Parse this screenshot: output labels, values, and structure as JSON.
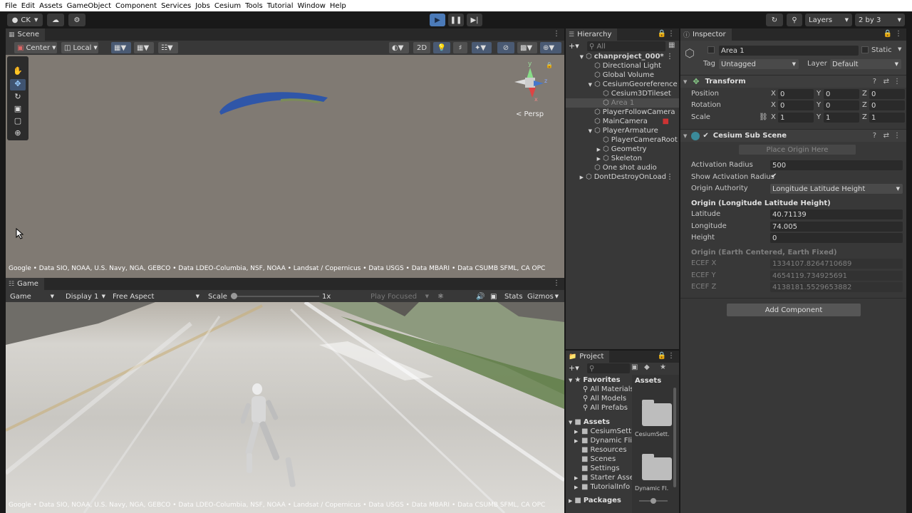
{
  "menu": [
    "File",
    "Edit",
    "Assets",
    "GameObject",
    "Component",
    "Services",
    "Jobs",
    "Cesium",
    "Tools",
    "Tutorial",
    "Window",
    "Help"
  ],
  "toolbar": {
    "account": "CK",
    "layers": "Layers",
    "layout": "2 by 3"
  },
  "scene": {
    "tab": "Scene",
    "pivot": "Center",
    "space": "Local",
    "mode2d": "2D",
    "persp": "< Persp",
    "credits": "Google • Data SIO, NOAA, U.S. Navy, NGA, GEBCO • Data LDEO-Columbia, NSF, NOAA • Landsat / Copernicus • Data USGS • Data MBARI • Data CSUMB SFML, CA OPC"
  },
  "game": {
    "tab": "Game",
    "view": "Game",
    "display": "Display 1",
    "aspect": "Free Aspect",
    "scale_label": "Scale",
    "scale_value": "1x",
    "play_mode": "Play Focused",
    "stats": "Stats",
    "gizmos": "Gizmos",
    "credits": "Google • Data SIO, NOAA, U.S. Navy, NGA, GEBCO • Data LDEO-Columbia, NSF, NOAA • Landsat / Copernicus • Data USGS • Data MBARI • Data CSUMB SFML, CA OPC"
  },
  "hierarchy": {
    "tab": "Hierarchy",
    "search": "All",
    "items": [
      {
        "label": "chanproject_000*",
        "depth": 0,
        "arrow": "▼",
        "bold": true
      },
      {
        "label": "Directional Light",
        "depth": 1,
        "arrow": ""
      },
      {
        "label": "Global Volume",
        "depth": 1,
        "arrow": ""
      },
      {
        "label": "CesiumGeoreference",
        "depth": 1,
        "arrow": "▼"
      },
      {
        "label": "Cesium3DTileset",
        "depth": 2,
        "arrow": ""
      },
      {
        "label": "Area 1",
        "depth": 2,
        "arrow": "",
        "selected": true
      },
      {
        "label": "PlayerFollowCamera",
        "depth": 1,
        "arrow": ""
      },
      {
        "label": "MainCamera",
        "depth": 1,
        "arrow": ""
      },
      {
        "label": "PlayerArmature",
        "depth": 1,
        "arrow": "▼"
      },
      {
        "label": "PlayerCameraRoot",
        "depth": 2,
        "arrow": ""
      },
      {
        "label": "Geometry",
        "depth": 2,
        "arrow": "▶"
      },
      {
        "label": "Skeleton",
        "depth": 2,
        "arrow": "▶"
      },
      {
        "label": "One shot audio",
        "depth": 1,
        "arrow": ""
      },
      {
        "label": "DontDestroyOnLoad",
        "depth": 0,
        "arrow": "▶"
      }
    ]
  },
  "inspector": {
    "tab": "Inspector",
    "name": "Area 1",
    "static": "Static",
    "tag_label": "Tag",
    "tag": "Untagged",
    "layer_label": "Layer",
    "layer": "Default",
    "transform": {
      "title": "Transform",
      "position_label": "Position",
      "rotation_label": "Rotation",
      "scale_label": "Scale",
      "position": [
        "0",
        "0",
        "0"
      ],
      "rotation": [
        "0",
        "0",
        "0"
      ],
      "scale": [
        "1",
        "1",
        "1"
      ]
    },
    "subscene": {
      "title": "Cesium Sub Scene",
      "place_origin": "Place Origin Here",
      "activation_radius_label": "Activation Radius",
      "activation_radius": "500",
      "show_radius_label": "Show Activation Radius",
      "origin_authority_label": "Origin Authority",
      "origin_authority": "Longitude Latitude Height",
      "origin_llh_header": "Origin (Longitude Latitude Height)",
      "latitude_label": "Latitude",
      "latitude": "40.71139",
      "longitude_label": "Longitude",
      "longitude": "74.005",
      "height_label": "Height",
      "height": "0",
      "origin_ecef_header": "Origin (Earth Centered, Earth Fixed)",
      "ecef_x_label": "ECEF X",
      "ecef_x": "1334107.8264710689",
      "ecef_y_label": "ECEF Y",
      "ecef_y": "4654119.734925691",
      "ecef_z_label": "ECEF Z",
      "ecef_z": "4138181.5529653882"
    },
    "add_component": "Add Component"
  },
  "project": {
    "tab": "Project",
    "favorites": "Favorites",
    "fav_items": [
      "All Materials",
      "All Models",
      "All Prefabs"
    ],
    "assets": "Assets",
    "asset_items": [
      "CesiumSettings",
      "Dynamic Fli",
      "Resources",
      "Scenes",
      "Settings",
      "Starter Assets",
      "TutorialInfo"
    ],
    "packages": "Packages",
    "breadcrumb": "Assets",
    "grid": [
      "CesiumSett.",
      "Dynamic Fl."
    ]
  },
  "axes": {
    "x": "x",
    "y": "y",
    "z": "z"
  }
}
